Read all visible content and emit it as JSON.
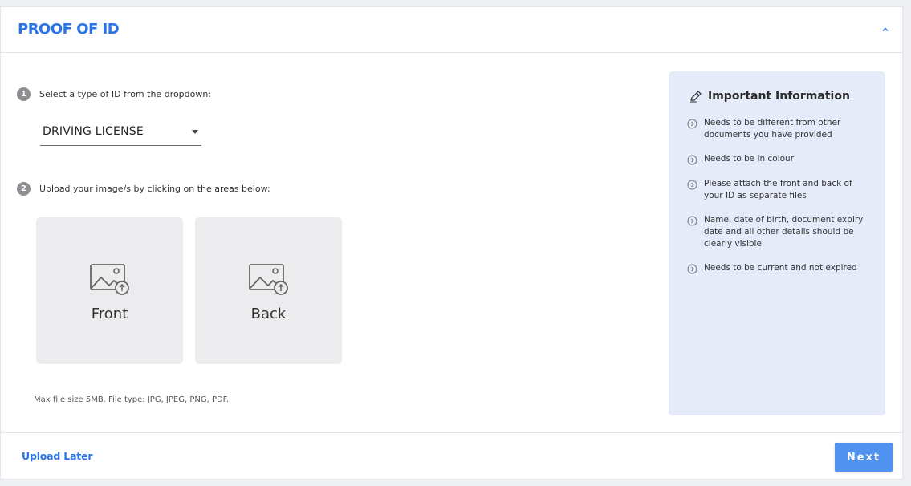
{
  "header": {
    "title": "PROOF OF ID",
    "collapse_icon": "chevron-up-icon"
  },
  "step1": {
    "number": "1",
    "text": "Select a type of ID from the dropdown:"
  },
  "id_select": {
    "value": "DRIVING LICENSE"
  },
  "step2": {
    "number": "2",
    "text": "Upload your image/s by clicking on the areas below:"
  },
  "uploads": [
    {
      "label": "Front",
      "icon": "image-upload-icon"
    },
    {
      "label": "Back",
      "icon": "image-upload-icon"
    }
  ],
  "hint": "Max file size 5MB. File type: JPG, JPEG, PNG, PDF.",
  "info": {
    "title": "Important Information",
    "icon": "pen-icon",
    "items": [
      "Needs to be different from other documents you have provided",
      "Needs to be in colour",
      "Please attach the front and back of your ID as separate files",
      "Name, date of birth, document expiry date and all other details should be clearly visible",
      "Needs to be current and not expired"
    ]
  },
  "footer": {
    "upload_later": "Upload Later",
    "next": "Next"
  },
  "colors": {
    "accent": "#2a74e6",
    "button": "#4f92ef",
    "info_bg": "#e6ebfa",
    "upload_bg": "#ececee"
  }
}
